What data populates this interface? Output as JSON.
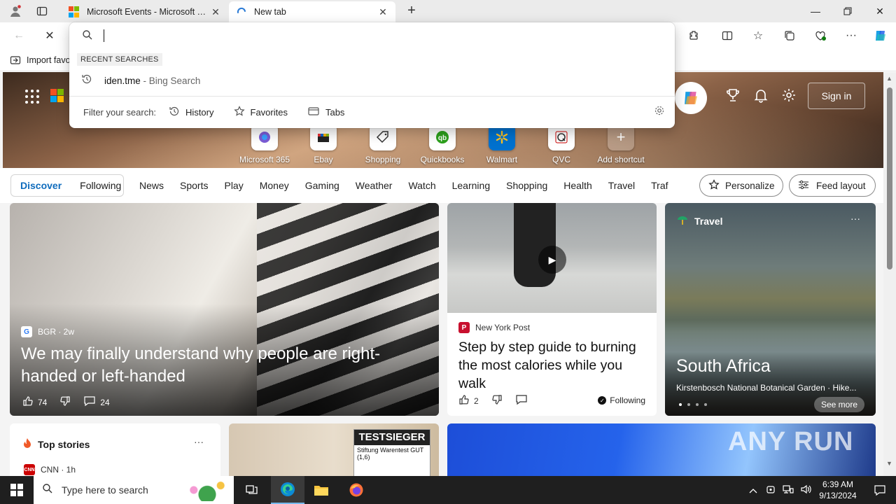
{
  "browser": {
    "tabs": [
      {
        "title": "Microsoft Events - Microsoft Tech",
        "active": false
      },
      {
        "title": "New tab",
        "active": true
      }
    ],
    "favorites_bar": {
      "import_label": "Import favo"
    }
  },
  "omnibox": {
    "value": "",
    "recent_label": "RECENT SEARCHES",
    "recent": [
      {
        "query": "iden.tme",
        "suffix": " - Bing Search"
      }
    ],
    "filter_label": "Filter your search:",
    "filters": [
      "History",
      "Favorites",
      "Tabs"
    ]
  },
  "newtab": {
    "sign_in": "Sign in",
    "shortcuts": [
      "Microsoft 365",
      "Ebay",
      "Shopping",
      "Quickbooks",
      "Walmart",
      "QVC",
      "Add shortcut"
    ],
    "feed_tabs": [
      "Discover",
      "Following"
    ],
    "nav": [
      "News",
      "Sports",
      "Play",
      "Money",
      "Gaming",
      "Weather",
      "Watch",
      "Learning",
      "Shopping",
      "Health",
      "Travel",
      "Traf"
    ],
    "personalize": "Personalize",
    "feed_layout": "Feed layout"
  },
  "cards": {
    "big": {
      "source": "BGR · 2w",
      "headline": "We may finally understand why people are right-handed or left-handed",
      "likes": "74",
      "comments": "24"
    },
    "mid": {
      "source": "New York Post",
      "headline": "Step by step guide to burning the most calories while you walk",
      "likes": "2",
      "following": "Following"
    },
    "travel": {
      "category": "Travel",
      "place": "South Africa",
      "desc": "Kirstenbosch National Botanical Garden · Hike...",
      "see_more": "See more"
    },
    "top_stories": {
      "title": "Top stories",
      "source": "CNN · 1h"
    },
    "test": {
      "badge_title": "TESTSIEGER",
      "badge_text": "Stiftung Warentest GUT (1,6)"
    }
  },
  "watermark": "ANY RUN",
  "taskbar": {
    "search_placeholder": "Type here to search",
    "time": "6:39 AM",
    "date": "9/13/2024"
  },
  "colors": {
    "accent": "#0f6cbd",
    "taskbar": "#1f1f1f"
  }
}
